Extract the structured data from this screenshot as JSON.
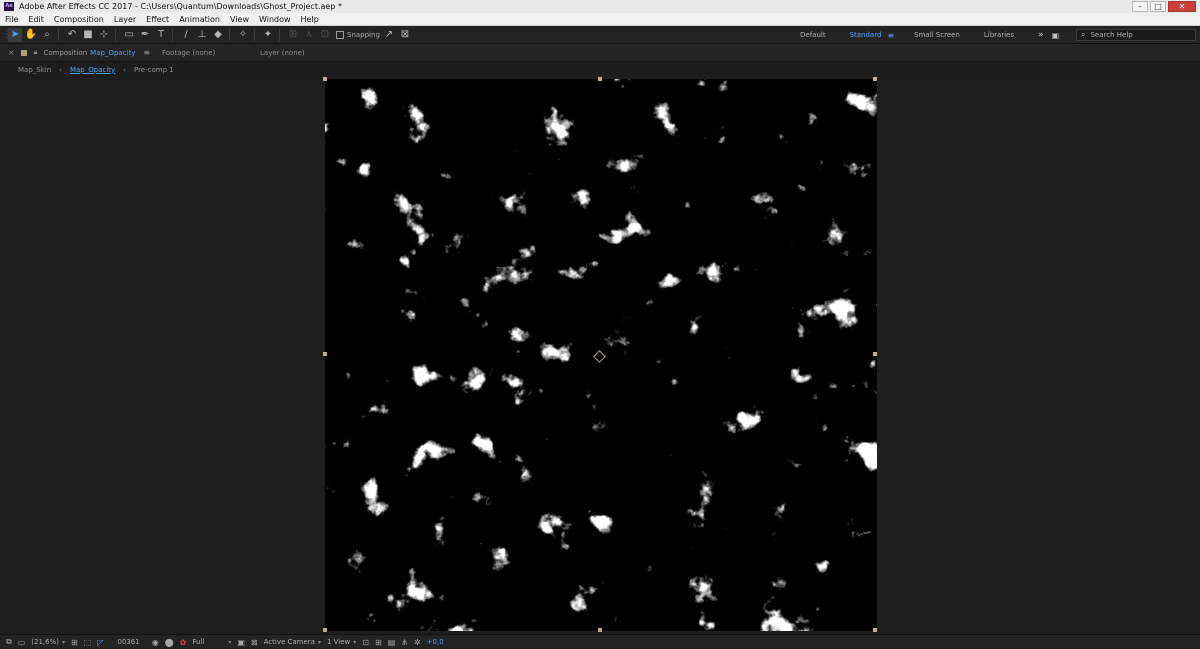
{
  "window": {
    "logo": "Ae",
    "title": "Adobe After Effects CC 2017 - C:\\Users\\Quantum\\Downloads\\Ghost_Project.aep *",
    "controls": [
      "–",
      "□",
      "✕"
    ]
  },
  "menu": [
    "File",
    "Edit",
    "Composition",
    "Layer",
    "Effect",
    "Animation",
    "View",
    "Window",
    "Help"
  ],
  "toolbar": {
    "snapping_label": "Snapping",
    "workspaces": [
      "Default",
      "Standard",
      "Small Screen",
      "Libraries"
    ],
    "active_workspace": "Standard",
    "more": "»",
    "search_placeholder": "Search Help"
  },
  "panel": {
    "comp_label": "Composition",
    "comp_name": "Map_Opacity",
    "menu_icon": "≡",
    "footage_tab": "Footage (none)",
    "layer_tab": "Layer (none)"
  },
  "breadcrumbs": {
    "items": [
      "Map_Skin",
      "Map_Opacity",
      "Pre-comp 1"
    ],
    "current": "Map_Opacity"
  },
  "footer": {
    "zoom": "(21,6%)",
    "timecode": "00361",
    "resolution": "Full",
    "camera": "Active Camera",
    "views": "1 View",
    "exposure": "+0,0"
  },
  "colors": {
    "accent": "#4da3ff",
    "handle": "#c5ae86",
    "comp_background": "#000000",
    "texture": "#ffffff"
  }
}
